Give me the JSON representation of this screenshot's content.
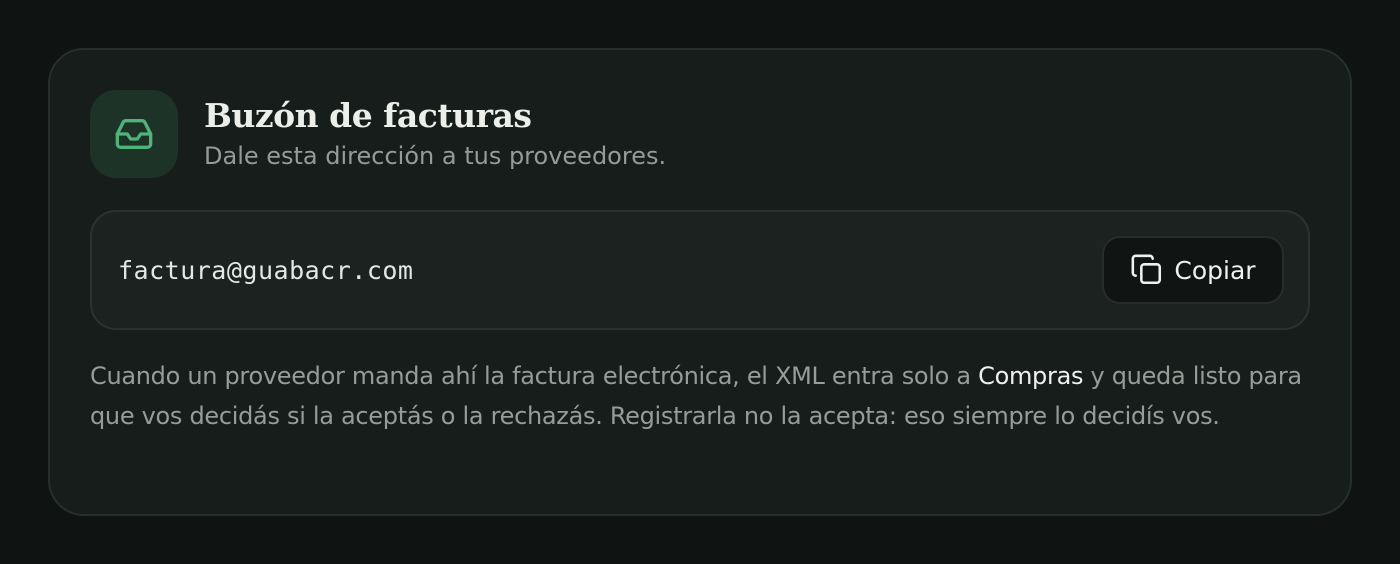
{
  "card": {
    "title": "Buzón de facturas",
    "subtitle": "Dale esta dirección a tus proveedores.",
    "icon": "inbox-icon"
  },
  "address": {
    "email": "factura@guabacr.com",
    "copy_label": "Copiar",
    "copy_icon": "copy-icon"
  },
  "description": {
    "part1": "Cuando un proveedor manda ahí la factura electrónica, el XML entra solo a ",
    "highlight": "Compras",
    "part2": " y queda listo para que vos decidás si la aceptás o la rechazás. Registrarla no la acepta: eso siempre lo decidís vos."
  },
  "colors": {
    "background": "#0f1311",
    "card": "#171d1a",
    "accent": "#4fb37a",
    "icon_tile": "#1d3327"
  }
}
